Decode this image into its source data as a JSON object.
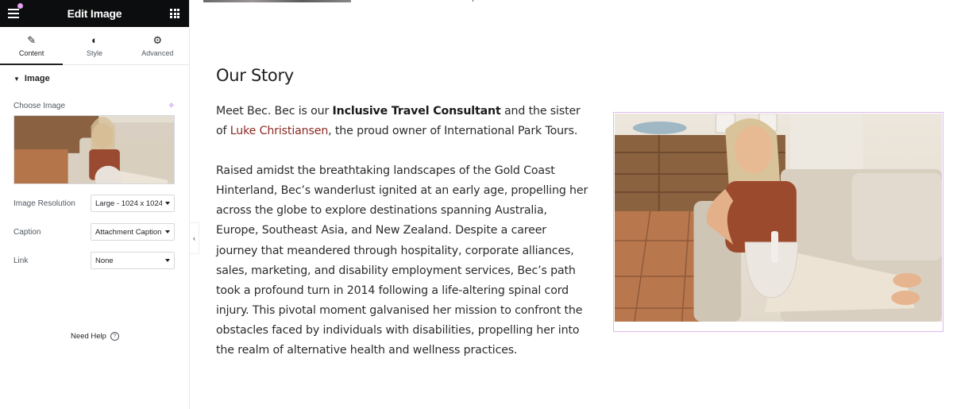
{
  "panel": {
    "title": "Edit Image",
    "tabs": [
      {
        "label": "Content",
        "icon": "pencil-icon",
        "active": true
      },
      {
        "label": "Style",
        "icon": "half-circle-icon",
        "active": false
      },
      {
        "label": "Advanced",
        "icon": "gear-icon",
        "active": false
      }
    ],
    "section": {
      "title": "Image",
      "choose_image_label": "Choose Image",
      "controls": [
        {
          "label": "Image Resolution",
          "value": "Large - 1024 x 1024"
        },
        {
          "label": "Caption",
          "value": "Attachment Caption"
        },
        {
          "label": "Link",
          "value": "None"
        }
      ]
    },
    "help_label": "Need Help",
    "help_icon": "question-circle-icon"
  },
  "preview": {
    "heading": "Our Story",
    "paragraph1": {
      "lead": "Meet Bec. Bec is our ",
      "bold": "Inclusive Travel Consultant",
      "mid": " and the sister of ",
      "link": "Luke Christiansen",
      "tail": ", the proud owner of International Park Tours."
    },
    "paragraph2": "Raised amidst the breathtaking landscapes of the Gold Coast Hinterland, Bec’s wanderlust ignited at an early age, propelling her across the globe to explore destinations spanning Australia, Europe, Southeast Asia, and New Zealand. Despite a career journey that meandered through hospitality, corporate alliances, sales, marketing, and disability employment services, Bec’s path took a profound turn in 2014 following a life-altering spinal cord injury. This pivotal moment galvanised her mission to confront the obstacles faced by individuals with disabilities, propelling her into the realm of alternative health and wellness practices.",
    "image_alt": "Bec sitting on a cream sofa holding a singing bowl"
  },
  "colors": {
    "link": "#8b2a22",
    "selection_outline": "#e0b9ef",
    "header_bg": "#0c0d0e",
    "ai_accent": "#b04ad2"
  }
}
